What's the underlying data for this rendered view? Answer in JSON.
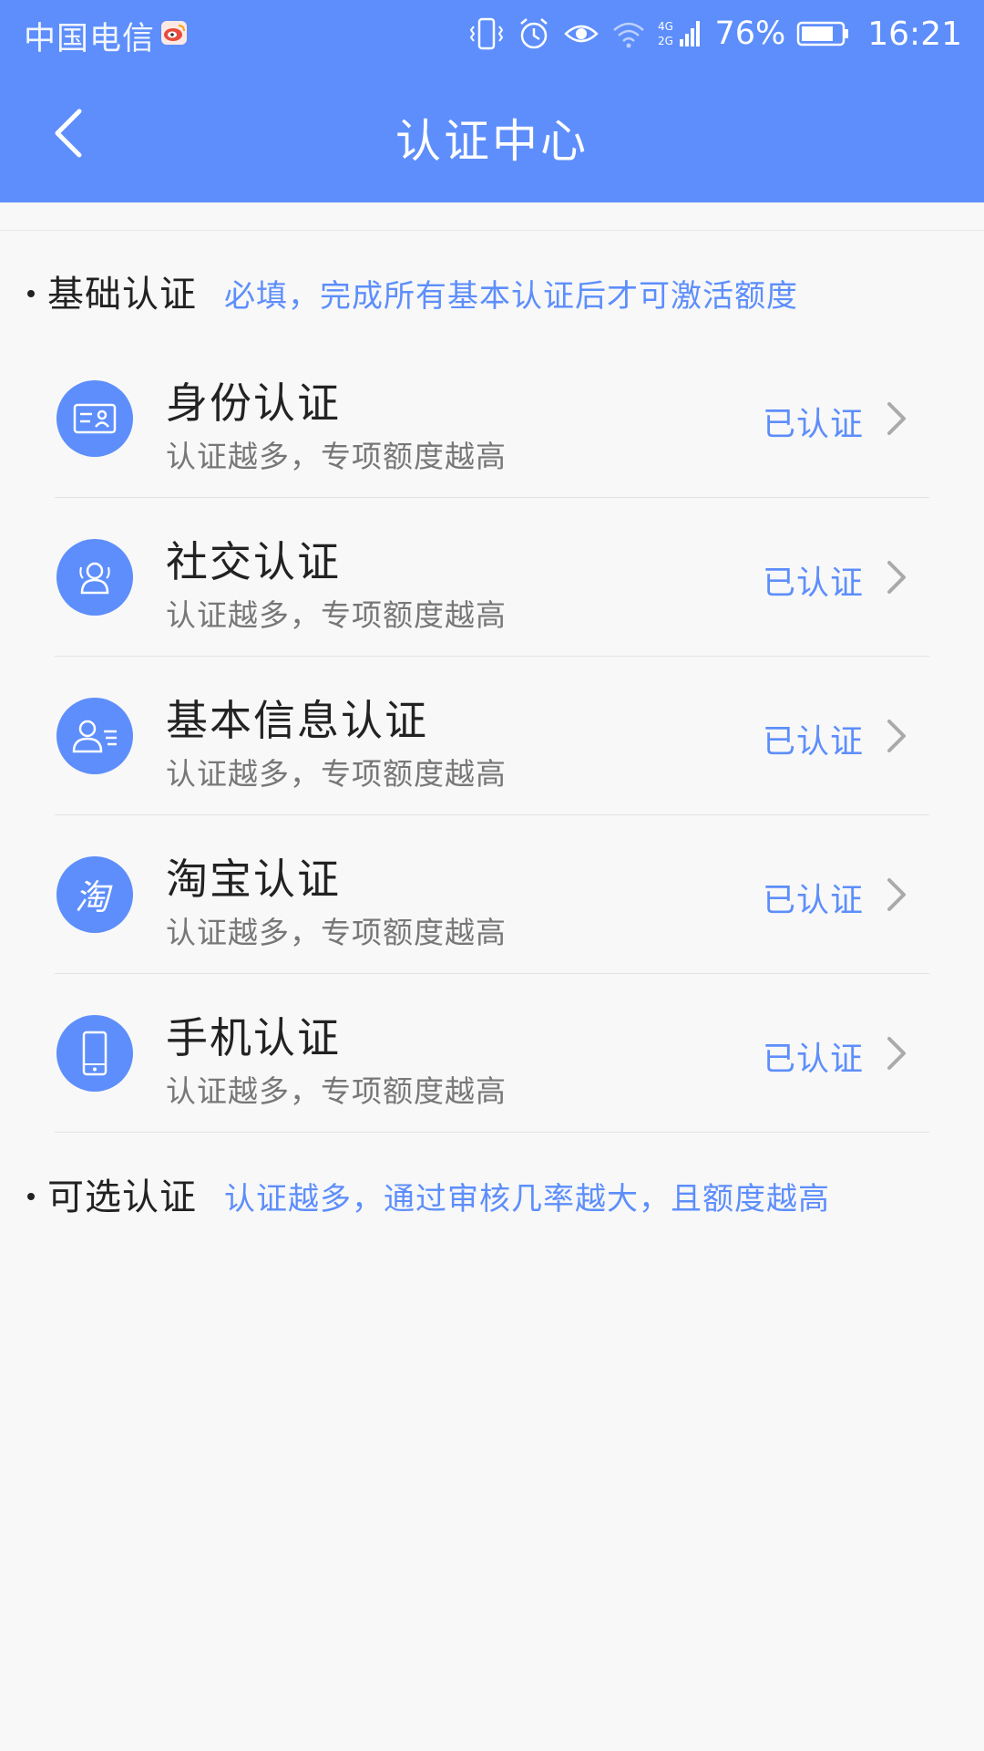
{
  "status_bar": {
    "carrier": "中国电信",
    "battery": "76%",
    "time": "16:21",
    "network": "4G 2G"
  },
  "header": {
    "title": "认证中心"
  },
  "basic_section": {
    "title": "基础认证",
    "subtitle": "必填，完成所有基本认证后才可激活额度"
  },
  "items": [
    {
      "title": "身份认证",
      "desc": "认证越多，专项额度越高",
      "status": "已认证",
      "icon": "id-card-icon"
    },
    {
      "title": "社交认证",
      "desc": "认证越多，专项额度越高",
      "status": "已认证",
      "icon": "contacts-icon"
    },
    {
      "title": "基本信息认证",
      "desc": "认证越多，专项额度越高",
      "status": "已认证",
      "icon": "profile-icon"
    },
    {
      "title": "淘宝认证",
      "desc": "认证越多，专项额度越高",
      "status": "已认证",
      "icon": "taobao-icon"
    },
    {
      "title": "手机认证",
      "desc": "认证越多，专项额度越高",
      "status": "已认证",
      "icon": "phone-icon"
    }
  ],
  "optional_section": {
    "title": "可选认证",
    "subtitle": "认证越多，通过审核几率越大，且额度越高"
  },
  "colors": {
    "accent": "#5d8efb",
    "background": "#f8f8f8",
    "text": "#222222",
    "secondary_text": "#777777"
  }
}
